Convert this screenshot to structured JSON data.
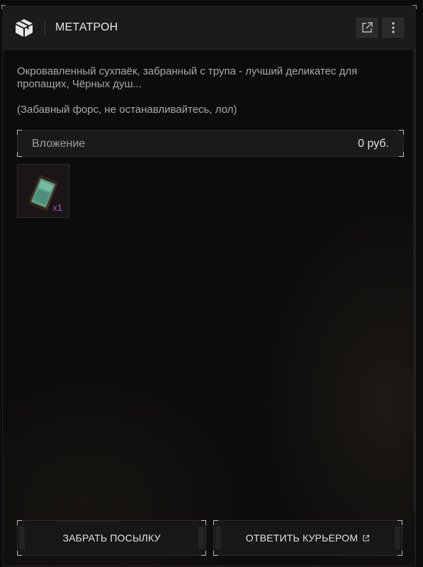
{
  "window": {
    "title": "МЕТАТРОН"
  },
  "icons": {
    "header": "package-icon",
    "external": "external-link-icon",
    "more": "more-vertical-icon",
    "item": "ration-pack-icon"
  },
  "message": {
    "description": "Окровавленный сухпаёк, забранный с трупа - лучший деликатес для пропащих, Чёрных душ...",
    "note": "(Забавный форс, не останавливайтесь, лол)"
  },
  "attachment": {
    "label": "Вложение",
    "value": "0  руб."
  },
  "items": [
    {
      "quantity": "x1"
    }
  ],
  "actions": {
    "take": "ЗАБРАТЬ ПОСЫЛКУ",
    "reply": "ОТВЕТИТЬ КУРЬЕРОМ"
  },
  "colors": {
    "quantity": "#b24fd0",
    "header_bg": "#1b1b1b",
    "window_bg": "#0c0c0c"
  }
}
